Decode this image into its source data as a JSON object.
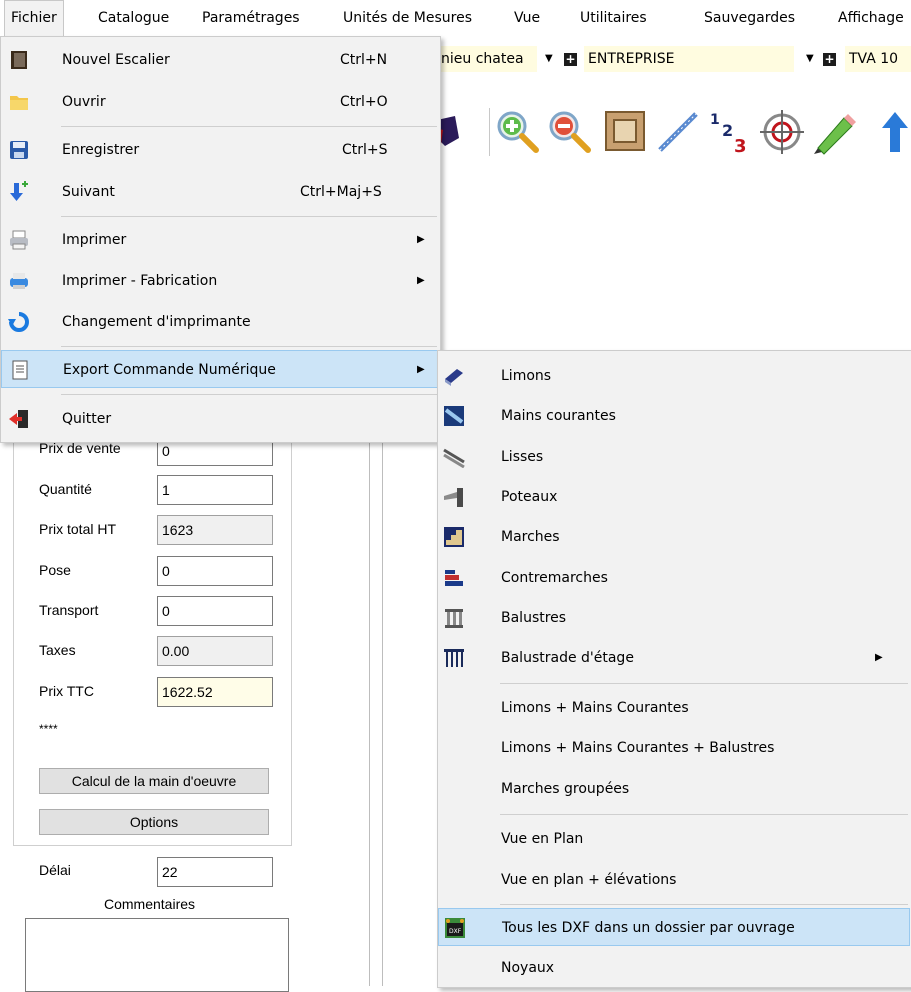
{
  "menubar": {
    "items": [
      "Fichier",
      "Catalogue",
      "Paramétrages",
      "Unités de Mesures",
      "Vue",
      "Utilitaires",
      "Sauvegardes",
      "Affichage"
    ]
  },
  "toolbar": {
    "combo1_value": "nieu chatea",
    "combo2_value": "ENTREPRISE",
    "combo3_value": "TVA 10"
  },
  "file_menu": {
    "items": [
      {
        "label": "Nouvel Escalier",
        "shortcut": "Ctrl+N",
        "icon": "book-icon"
      },
      {
        "label": "Ouvrir",
        "shortcut": "Ctrl+O",
        "icon": "folder-icon"
      },
      {
        "label": "Enregistrer",
        "shortcut": "Ctrl+S",
        "icon": "floppy-icon"
      },
      {
        "label": "Suivant",
        "shortcut": "Ctrl+Maj+S",
        "icon": "next-arrow-icon"
      },
      {
        "label": "Imprimer",
        "shortcut": "",
        "icon": "printer-icon",
        "submenu": true
      },
      {
        "label": "Imprimer - Fabrication",
        "shortcut": "",
        "icon": "printer-fab-icon",
        "submenu": true
      },
      {
        "label": "Changement d'imprimante",
        "shortcut": "",
        "icon": "refresh-icon"
      },
      {
        "label": "Export Commande Numérique",
        "shortcut": "",
        "icon": "document-icon",
        "submenu": true,
        "highlighted": true
      },
      {
        "label": "Quitter",
        "shortcut": "",
        "icon": "exit-door-icon"
      }
    ]
  },
  "export_menu": {
    "items": [
      {
        "label": "Limons",
        "icon": "limon-icon"
      },
      {
        "label": "Mains courantes",
        "icon": "handrail-icon"
      },
      {
        "label": "Lisses",
        "icon": "rails-icon"
      },
      {
        "label": "Poteaux",
        "icon": "post-icon"
      },
      {
        "label": "Marches",
        "icon": "stairs-icon"
      },
      {
        "label": "Contremarches",
        "icon": "riser-icon"
      },
      {
        "label": "Balustres",
        "icon": "baluster-icon"
      },
      {
        "label": "Balustrade d'étage",
        "icon": "balustrade-icon",
        "submenu": true
      },
      {
        "label": "Limons + Mains Courantes"
      },
      {
        "label": "Limons + Mains Courantes + Balustres"
      },
      {
        "label": "Marches groupées"
      },
      {
        "label": "Vue en Plan"
      },
      {
        "label": "Vue en plan + élévations"
      },
      {
        "label": "Tous les DXF dans un dossier par ouvrage",
        "icon": "dxf-icon",
        "highlighted": true
      },
      {
        "label": "Noyaux"
      }
    ]
  },
  "form": {
    "prix_vente_label": "Prix de vente",
    "prix_vente_value": "0",
    "quantite_label": "Quantité",
    "quantite_value": "1",
    "prix_total_label": "Prix total HT",
    "prix_total_value": "1623",
    "pose_label": "Pose",
    "pose_value": "0",
    "transport_label": "Transport",
    "transport_value": "0",
    "taxes_label": "Taxes",
    "taxes_value": "0.00",
    "prix_ttc_label": "Prix TTC",
    "prix_ttc_value": "1622.52",
    "stars": "****",
    "calc_button": "Calcul de la main d'oeuvre",
    "options_button": "Options",
    "delai_label": "Délai",
    "delai_value": "22",
    "commentaires_label": "Commentaires"
  }
}
